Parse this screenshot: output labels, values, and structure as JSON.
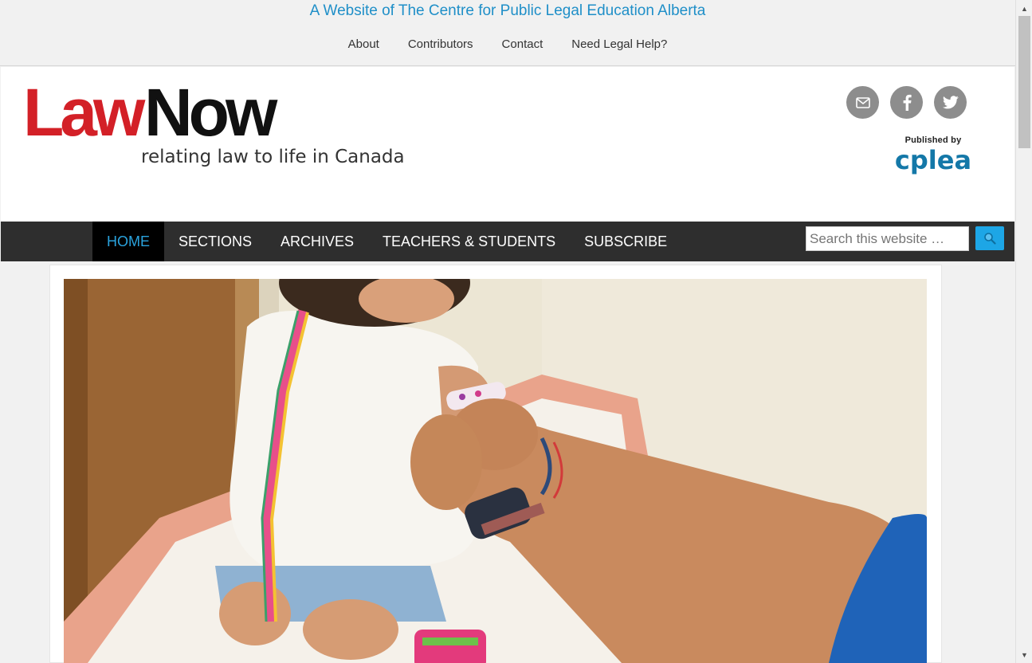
{
  "top": {
    "tagline": "A Website of The Centre for Public Legal Education Alberta",
    "nav": [
      "About",
      "Contributors",
      "Contact",
      "Need Legal Help?"
    ]
  },
  "header": {
    "logo_law": "Law",
    "logo_now": "Now",
    "logo_tagline": "relating law to life in Canada",
    "published_by": "Published by",
    "publisher": "cplea",
    "social_icons": [
      "email-icon",
      "facebook-icon",
      "twitter-icon"
    ]
  },
  "mainnav": {
    "items": [
      "HOME",
      "SECTIONS",
      "ARCHIVES",
      "TEACHERS & STUDENTS",
      "SUBSCRIBE"
    ],
    "active_index": 0
  },
  "search": {
    "placeholder": "Search this website …"
  },
  "colors": {
    "accent": "#1da6e6",
    "logo_red": "#d32027",
    "nav_bg": "#2e2e2e",
    "tagline": "#1f8fc8"
  }
}
